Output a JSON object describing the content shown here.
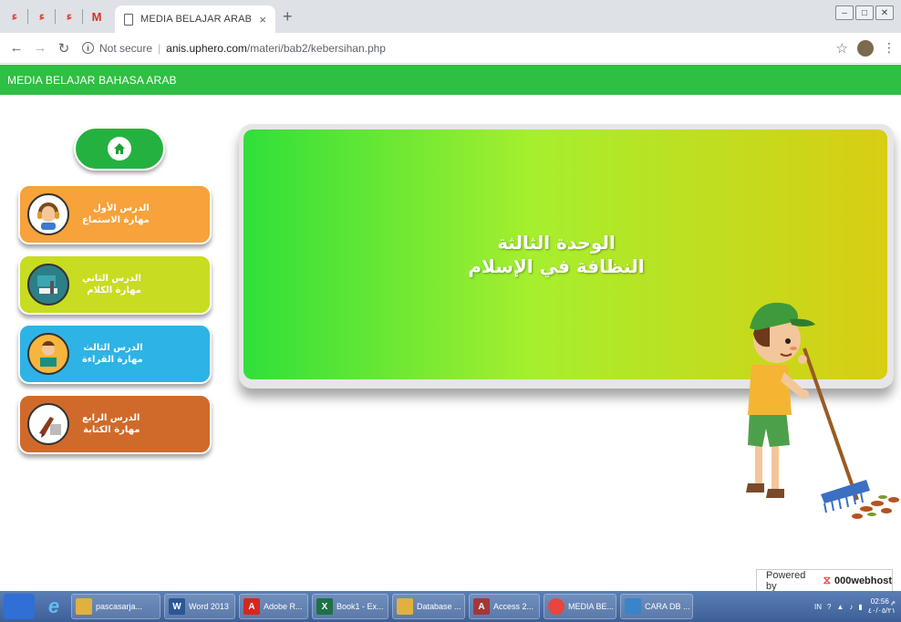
{
  "browser": {
    "tab_title": "MEDIA BELAJAR ARAB",
    "tab_close": "×",
    "new_tab": "+",
    "pinned_tabs": [
      "ء",
      "ء",
      "ء",
      "M"
    ],
    "url_status": "Not secure",
    "url_host": "anis.uphero.com",
    "url_path": "/materi/bab2/kebersihan.php"
  },
  "site": {
    "header_title": "MEDIA BELAJAR BAHASA ARAB"
  },
  "lessons": [
    {
      "line1": "الدرس الأول",
      "line2": "مهارة الاستماع",
      "icon": "headphones-boy-icon",
      "color": "#f7a23b"
    },
    {
      "line1": "الدرس الثاني",
      "line2": "مهارة الكلام",
      "icon": "classroom-icon",
      "color": "#c8dc21"
    },
    {
      "line1": "الدرس الثالث",
      "line2": "مهارة القراءة",
      "icon": "reading-boy-icon",
      "color": "#2eb3e6"
    },
    {
      "line1": "الدرس الرابع",
      "line2": "مهارة الكتابة",
      "icon": "writing-hand-icon",
      "color": "#d06a2a"
    }
  ],
  "banner": {
    "line1": "الوحدة الثالثة",
    "line2": "النظافة في الإسلام"
  },
  "footer": {
    "powered_by": "Powered by",
    "brand": "000webhost"
  },
  "taskbar": {
    "items": [
      {
        "label": "pascasarja...",
        "icon_color": "#e0b040"
      },
      {
        "label": "Word 2013",
        "icon_color": "#2b5797"
      },
      {
        "label": "Adobe R...",
        "icon_color": "#d3281f"
      },
      {
        "label": "Book1 - Ex...",
        "icon_color": "#1e7145"
      },
      {
        "label": "Database ...",
        "icon_color": "#e0b040"
      },
      {
        "label": "Access 2...",
        "icon_color": "#a4373a"
      },
      {
        "label": "MEDIA BE...",
        "icon_color": "#e8453c"
      },
      {
        "label": "CARA DB ...",
        "icon_color": "#3a84c9"
      }
    ],
    "lang": "IN",
    "time": "02:56 م",
    "date": "٤٠/٠٥/٢١"
  }
}
